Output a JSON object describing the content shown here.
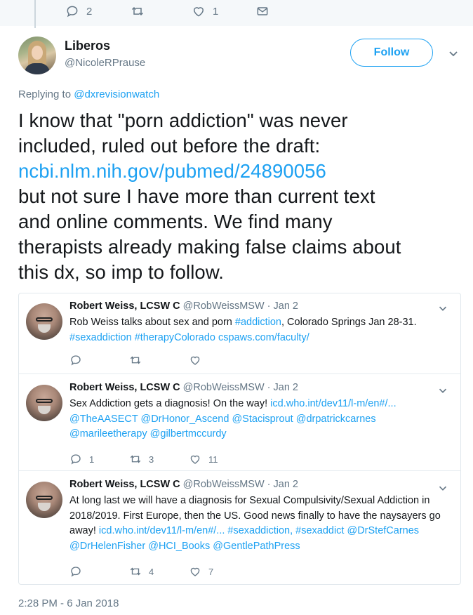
{
  "prev_tweet_actions": {
    "reply": {
      "icon": "reply-icon",
      "count": "2"
    },
    "retweet": {
      "icon": "retweet-icon",
      "count": ""
    },
    "like": {
      "icon": "heart-icon",
      "count": "1"
    },
    "dm": {
      "icon": "envelope-icon"
    }
  },
  "tweet": {
    "display_name": "Liberos",
    "screen_name": "@NicoleRPrause",
    "follow_label": "Follow",
    "replying_prefix": "Replying to ",
    "replying_handle": "@dxrevisionwatch",
    "text_lines": [
      "I know that \"porn addiction\" was never",
      "included, ruled out before the draft:",
      "ncbi.nlm.nih.gov/pubmed/24890056",
      "but not sure I have more than current text",
      "and online comments. We find many",
      "therapists already making false claims about",
      "this dx, so imp to follow."
    ],
    "timestamp": "2:28 PM - 6 Jan 2018"
  },
  "quoted_tweets": [
    {
      "name": "Robert Weiss, LCSW C",
      "handle_date": "@RobWeissMSW · Jan 2",
      "lines": [
        [
          {
            "t": "Rob Weiss talks about sex and porn ",
            "link": false
          },
          {
            "t": "#addiction",
            "link": true
          },
          {
            "t": ", Colorado Springs Jan 28-31.",
            "link": false
          }
        ],
        [
          {
            "t": "#sexaddiction #therapyColorado cspaws.com/faculty/",
            "link": true
          }
        ]
      ],
      "reply_count": "",
      "retweet_count": "",
      "like_count": ""
    },
    {
      "name": "Robert Weiss, LCSW C",
      "handle_date": "@RobWeissMSW · Jan 2",
      "lines": [
        [
          {
            "t": "Sex Addiction gets a diagnosis! On the way! ",
            "link": false
          },
          {
            "t": "icd.who.int/dev11/l-m/en#/...",
            "link": true
          }
        ],
        [
          {
            "t": "@TheAASECT @DrHonor_Ascend @Stacisprout @drpatrickcarnes",
            "link": true
          }
        ],
        [
          {
            "t": "@marileetherapy @gilbertmccurdy",
            "link": true
          }
        ]
      ],
      "reply_count": "1",
      "retweet_count": "3",
      "like_count": "11"
    },
    {
      "name": "Robert Weiss, LCSW C",
      "handle_date": "@RobWeissMSW · Jan 2",
      "lines": [
        [
          {
            "t": "At long last we will have a diagnosis for Sexual Compulsivity/Sexual Addiction in",
            "link": false
          }
        ],
        [
          {
            "t": "2018/2019. First Europe, then the US. Good news finally to have the naysayers go",
            "link": false
          }
        ],
        [
          {
            "t": "away! ",
            "link": false
          },
          {
            "t": "icd.who.int/dev11/l-m/en#/... #sexaddiction, #sexaddict @DrStefCarnes",
            "link": true
          }
        ],
        [
          {
            "t": "@DrHelenFisher @HCI_Books @GentlePathPress",
            "link": true
          }
        ]
      ],
      "reply_count": "",
      "retweet_count": "4",
      "like_count": "7"
    }
  ],
  "colors": {
    "accent": "#1da1f2",
    "text": "#14171a",
    "muted": "#657786",
    "border": "#e1e8ed"
  }
}
